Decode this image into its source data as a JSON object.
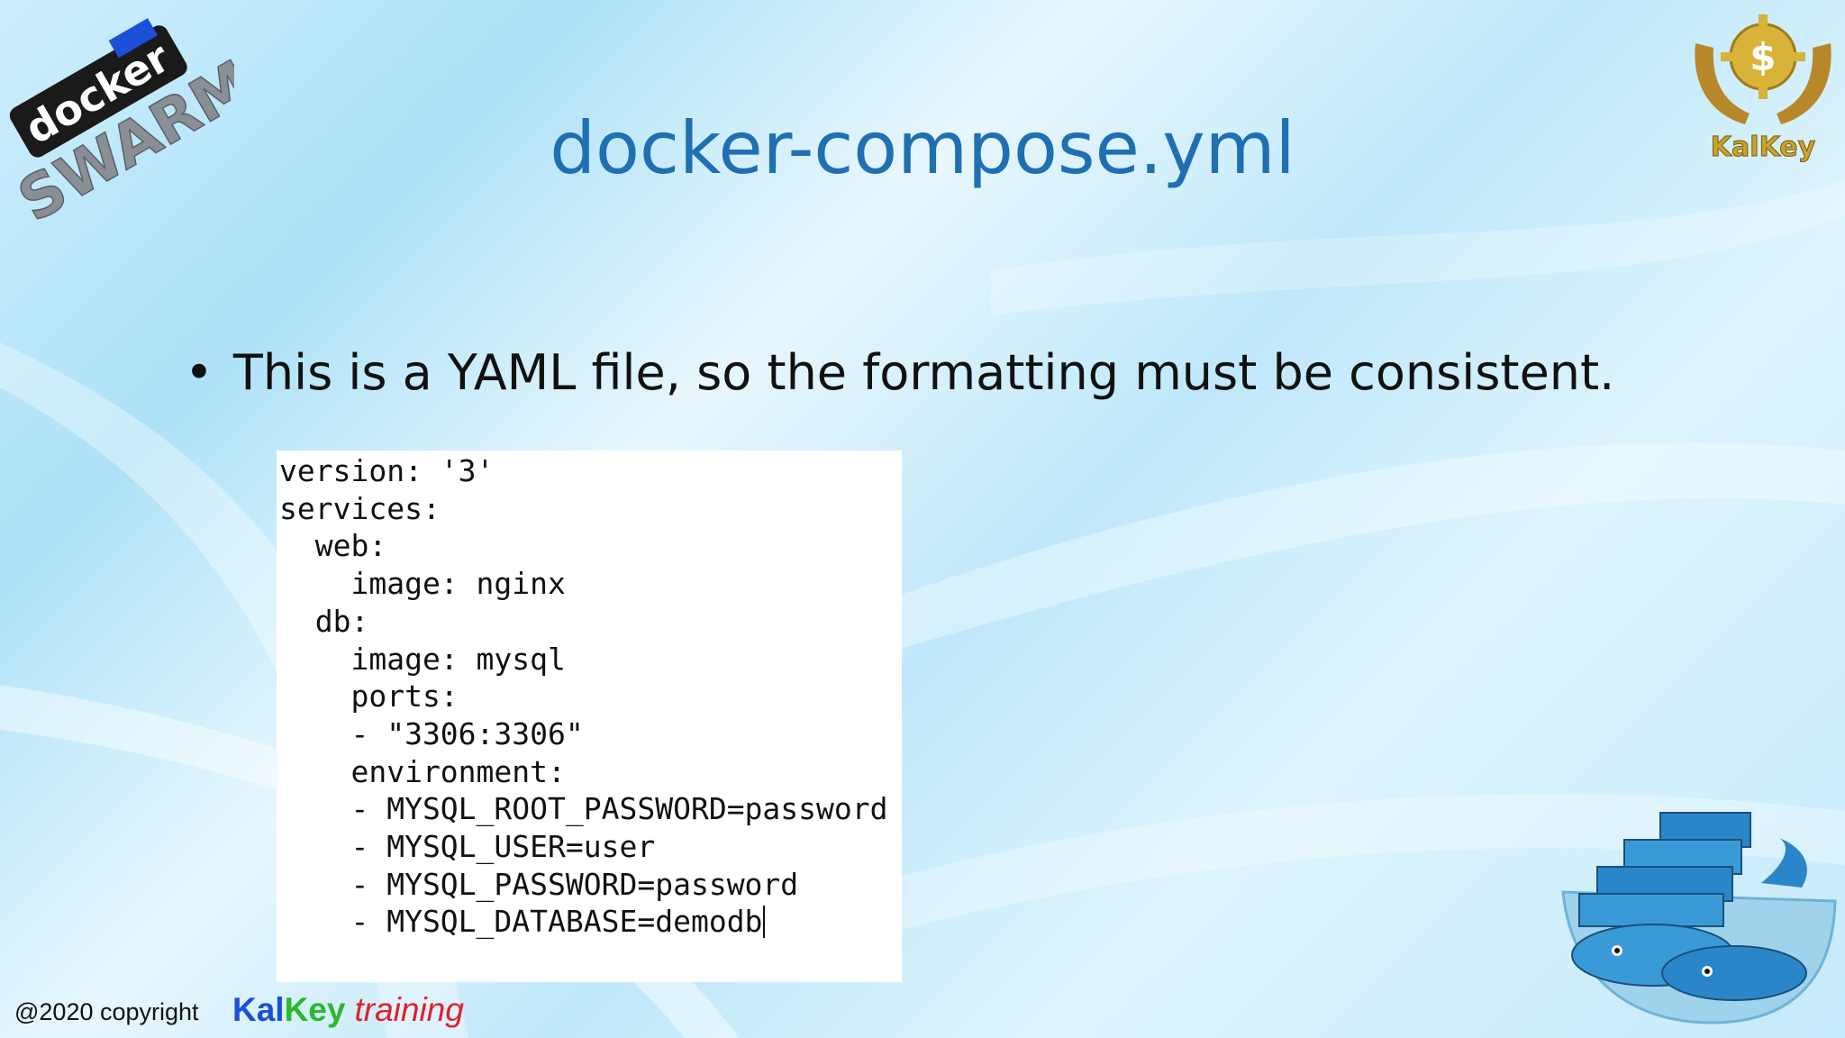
{
  "slide": {
    "title": "docker-compose.yml",
    "bullet_symbol": "•",
    "bullet_text": "This is a YAML file, so the formatting must be consistent."
  },
  "code": {
    "lines": [
      "version: '3'",
      "services:",
      "  web:",
      "    image: nginx",
      "  db:",
      "    image: mysql",
      "    ports:",
      "    - \"3306:3306\"",
      "    environment:",
      "    - MYSQL_ROOT_PASSWORD=password",
      "    - MYSQL_USER=user",
      "    - MYSQL_PASSWORD=password",
      "    - MYSQL_DATABASE=demodb"
    ]
  },
  "footer": {
    "copyright": "@2020 copyright",
    "brand_kal": "Kal",
    "brand_key": "Key",
    "brand_training": "training"
  },
  "logos": {
    "swarm_top": "docker",
    "swarm_bottom": "SWARM",
    "kalkey": "KalKey",
    "kalkey_symbol": "$"
  },
  "colors": {
    "title": "#1f6fb2",
    "brand_blue": "#1a4fd6",
    "brand_green": "#2bb82b",
    "brand_red": "#e0202b",
    "gold": "#c9a227"
  },
  "icons": [
    "docker-swarm-logo",
    "kalkey-logo-icon",
    "docker-whale-containers-icon"
  ]
}
